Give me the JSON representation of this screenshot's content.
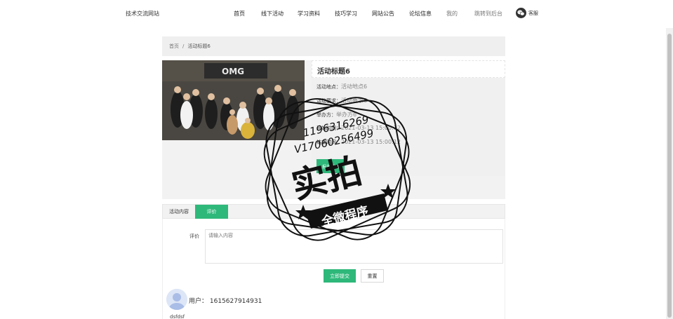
{
  "site": {
    "brand": "技术交流网站",
    "nav": [
      "首页",
      "线下活动",
      "学习资料",
      "技巧学习",
      "网站公告",
      "论坛信息",
      "我的",
      "跳转到后台"
    ],
    "service_label": "客服"
  },
  "breadcrumb": {
    "home": "首页",
    "separator": "/",
    "current": "活动标题6"
  },
  "activity": {
    "title": "活动标题6",
    "location_label": "活动地点：",
    "location": "活动地点6",
    "requirement_label": "活动要求：",
    "requirement": "活动要求6",
    "organizer_label": "举办方：",
    "organizer": "举办方6",
    "start_label": "开始时间：",
    "start": "2021-03-13 15:00:12",
    "end_label": "结束时间：",
    "end": "2021-03-13 15:00:12",
    "signup_label": "报名活动"
  },
  "tabs": {
    "content": "活动内容",
    "evaluation": "评价"
  },
  "review": {
    "label": "评价",
    "placeholder": "请输入内容",
    "submit": "立即提交",
    "reset": "重置"
  },
  "comment": {
    "user_line": "用户：   1615627914931",
    "text": "dsfdsf"
  },
  "watermark": {
    "qq": "1196316269",
    "vx": "V17060256499",
    "main": "实拍",
    "sub": "全微程序"
  },
  "colors": {
    "accent": "#2eb87a"
  }
}
